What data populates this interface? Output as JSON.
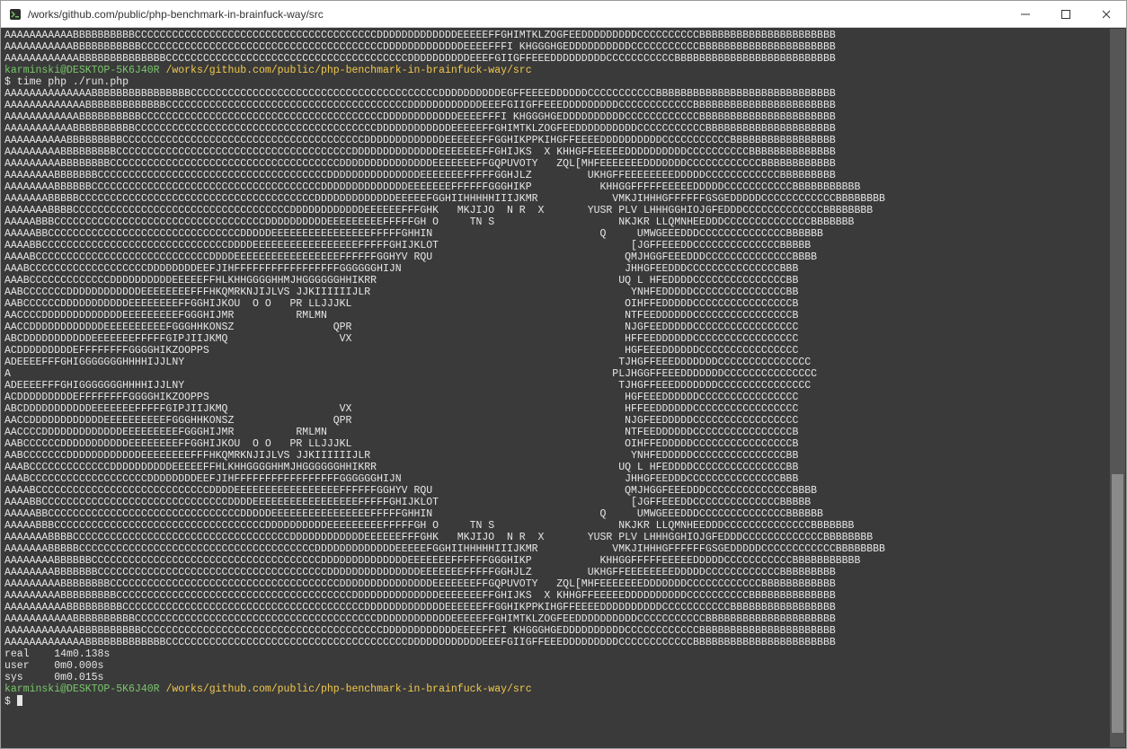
{
  "window": {
    "title": "/works/github.com/public/php-benchmark-in-brainfuck-way/src"
  },
  "prompt": {
    "user_host": "karminski@DESKTOP-5K6J40R",
    "path": "/works/github.com/public/php-benchmark-in-brainfuck-way/src",
    "command": "$ time php ./run.php",
    "final_prompt": "$ "
  },
  "timing": {
    "real_label": "real",
    "real_value": "14m0.138s",
    "user_label": "user",
    "user_value": "0m0.000s",
    "sys_label": "sys",
    "sys_value": "0m0.015s"
  },
  "top_lines": [
    "AAAAAAAAAAABBBBBBBBBBCCCCCCCCCCCCCCCCCCCCCCCCCCCCCCCCCCCCCCCDDDDDDDDDDDDDEEEEEFFGHIMTKLZOGFEEDDDDDDDDDCCCCCCCCCCBBBBBBBBBBBBBBBBBBBBBB",
    "AAAAAAAAAAABBBBBBBBBBBCCCCCCCCCCCCCCCCCCCCCCCCCCCCCCCCCCCCCCCDDDDDDDDDDDDDEEEEFFFI KHGGGHGEDDDDDDDDDDCCCCCCCCCCCBBBBBBBBBBBBBBBBBBBBBB",
    "AAAAAAAAAAAABBBBBBBBBBBBBBCCCCCCCCCCCCCCCCCCCCCCCCCCCCCCCCCCCCCCCDDDDDDDDDDEEEFGIIGFFEEEDDDDDDDDDCCCCCCCCCCCBBBBBBBBBBBBBBBBBBBBBBBBBB"
  ],
  "run_lines": [
    "AAAAAAAAAAAAAABBBBBBBBBBBBBBBBCCCCCCCCCCCCCCCCCCCCCCCCCCCCCCCCCCCCCCCCDDDDDDDDDDEGFFEEEEDDDDDDCCCCCCCCCCCBBBBBBBBBBBBBBBBBBBBBBBBBBBBB",
    "AAAAAAAAAAAAABBBBBBBBBBBBBCCCCCCCCCCCCCCCCCCCCCCCCCCCCCCCCCCCCCCCDDDDDDDDDDDDEEEFGIIGFFEEEDDDDDDDDDCCCCCCCCCCCCBBBBBBBBBBBBBBBBBBBBBBB",
    "AAAAAAAAAAAABBBBBBBBBBCCCCCCCCCCCCCCCCCCCCCCCCCCCCCCCCCCCCCCCDDDDDDDDDDDDEEEEFFFI KHGGGHGEDDDDDDDDDDCCCCCCCCCCCCBBBBBBBBBBBBBBBBBBBBBB",
    "AAAAAAAAAAABBBBBBBBBBCCCCCCCCCCCCCCCCCCCCCCCCCCCCCCCCCCCCCCCDDDDDDDDDDDDEEEEEFFGHIMTKLZOGFEEDDDDDDDDDDCCCCCCCCCCCBBBBBBBBBBBBBBBBBBBBB",
    "AAAAAAAAAABBBBBBBBBCCCCCCCCCCCCCCCCCCCCCCCCCCCCCCCCCCCCCCCDDDDDDDDDDDDDEEEEEEFFGGHIKPPKIHGFFEEEEDDDDDDDDDDCCCCCCCCCCCBBBBBBBBBBBBBBBBB",
    "AAAAAAAAABBBBBBBBBCCCCCCCCCCCCCCCCCCCCCCCCCCCCCCCCCCCCCCDDDDDDDDDDDDDDEEEEEEEFFGHIJKS  X KHHGFFEEEEEDDDDDDDDDDCCCCCCCCCCBBBBBBBBBBBBBB",
    "AAAAAAAAABBBBBBBBCCCCCCCCCCCCCCCCCCCCCCCCCCCCCCCCCCCCCDDDDDDDDDDDDDDDEEEEEEEFFGQPUVOTY   ZQL[MHFEEEEEEEDDDDDDDCCCCCCCCCCCCBBBBBBBBBBBB",
    "AAAAAAAABBBBBBBCCCCCCCCCCCCCCCCCCCCCCCCCCCCCCCCCCCCCDDDDDDDDDDDDDDDEEEEEEEFFFFFGGHJLZ         UKHGFFEEEEEEEEDDDDDCCCCCCCCCCCCBBBBBBBBB",
    "AAAAAAAABBBBBBCCCCCCCCCCCCCCCCCCCCCCCCCCCCCCCCCCCCCDDDDDDDDDDDDDDEEEEEEEFFFFFFGGGHIKP           KHHGGFFFFFEEEEEDDDDDCCCCCCCCCCCBBBBBBBBBBB",
    "AAAAAAABBBBBCCCCCCCCCCCCCCCCCCCCCCCCCCCCCCCCCCCCCCDDDDDDDDDDDDDEEEEEFGGHIIHHHHHIIIJKMR            VMKJIHHHGFFFFFFGSGEDDDDDCCCCCCCCCCCCBBBBBBBB",
    "AAAAAAABBBBCCCCCCCCCCCCCCCCCCCCCCCCCCCCCCCCCCCDDDDDDDDDDDDEEEEEEFFFGHK   MKJIJO  N R  X       YUSR PLV LHHHGGHIOJGFEDDDCCCCCCCCCCCCCBBBBBBBB",
    "AAAAABBBCCCCCCCCCCCCCCCCCCCCCCCCCCCCCCCCCCDDDDDDDDDDEEEEEEEEEFFFFFGH O     TN S                    NKJKR LLQMNHEEDDDCCCCCCCCCCCCCCBBBBBBB",
    "AAAAABBCCCCCCCCCCCCCCCCCCCCCCCCCCCCCCCDDDDDEEEEEEEEEEEEEEEEFFFFFGHHIN                           Q     UMWGEEEDDDCCCCCCCCCCCCCCBBBBBB",
    "AAAABBCCCCCCCCCCCCCCCCCCCCCCCCCCCCCCDDDDEEEEEEEEEEEEEEEEEFFFFFGHIJKLOT                               [JGFFEEEDDCCCCCCCCCCCCCCBBBBB",
    "AAAABCCCCCCCCCCCCCCCCCCCCCCCCCCCCDDDDEEEEEEEEEEEEEEEEEFFFFFFGGHYV RQU                               QMJHGGFEEEDDDCCCCCCCCCCCCCCBBBB",
    "AAABCCCCCCCCCCCCCCCCCCCDDDDDDDDEEFJIHFFFFFFFFFFFFFFFFFGGGGGGHIJN                                    JHHGFEEDDDCCCCCCCCCCCCCCCBBB",
    "AAABCCCCCCCCCCCCCDDDDDDDDDDEEEEEFFHLKHHGGGGHHMJHGGGGGGHHIKRR                                       UQ L HFEDDDDCCCCCCCCCCCCCCCBB",
    "AABCCCCCCCDDDDDDDDDDDDEEEEEEEEFFFHKQMRKNJIJLVS JJKIIIIIIJLR                                          YNHFEDDDDDCCCCCCCCCCCCCCCBB",
    "AABCCCCCCDDDDDDDDDDDEEEEEEEEFFGGHIJKOU  O O   PR LLJJJKL                                            OIHFFEDDDDDCCCCCCCCCCCCCCCCB",
    "AACCCCDDDDDDDDDDDDDEEEEEEEEEFGGGHIJMR          RMLMN                                                NTFEEDDDDDDCCCCCCCCCCCCCCCCB",
    "AACCDDDDDDDDDDDDEEEEEEEEEEFGGGHHKONSZ                QPR                                            NJGFEEDDDDDCCCCCCCCCCCCCCCCC",
    "ABCDDDDDDDDDDDEEEEEEEFFFFFGIPJIIJKMQ                  VX                                            HFFEEDDDDDDCCCCCCCCCCCCCCCCC",
    "ACDDDDDDDDDEFFFFFFFFGGGGHIKZOOPPS                                                                   HGFEEEDDDDDDCCCCCCCCCCCCCCCC",
    "ADEEEEFFFGHIGGGGGGGHHHHIJJLNY                                                                      TJHGFFEEEDDDDDDDCCCCCCCCCCCCCCC",
    "A                                                                                                 PLJHGGFFEEEDDDDDDDCCCCCCCCCCCCCCC",
    "ADEEEEFFFGHIGGGGGGGHHHHIJJLNY                                                                      TJHGFFEEEDDDDDDDCCCCCCCCCCCCCCC",
    "ACDDDDDDDDDEFFFFFFFFGGGGHIKZOOPPS                                                                   HGFEEEDDDDDDCCCCCCCCCCCCCCCC",
    "ABCDDDDDDDDDDDEEEEEEEFFFFFGIPJIIJKMQ                  VX                                            HFFEEDDDDDDCCCCCCCCCCCCCCCCC",
    "AACCDDDDDDDDDDDDEEEEEEEEEEFGGGHHKONSZ                QPR                                            NJGFEEDDDDDCCCCCCCCCCCCCCCCC",
    "AACCCCDDDDDDDDDDDDDEEEEEEEEEFGGGHIJMR          RMLMN                                                NTFEEDDDDDDCCCCCCCCCCCCCCCCB",
    "AABCCCCCCDDDDDDDDDDDEEEEEEEEFFGGHIJKOU  O O   PR LLJJJKL                                            OIHFFEDDDDDCCCCCCCCCCCCCCCCB",
    "AABCCCCCCCDDDDDDDDDDDDEEEEEEEEFFFHKQMRKNJIJLVS JJKIIIIIIJLR                                          YNHFEDDDDDCCCCCCCCCCCCCCCBB",
    "AAABCCCCCCCCCCCCCDDDDDDDDDDEEEEEFFHLKHHGGGGHHMJHGGGGGGHHIKRR                                       UQ L HFEDDDDCCCCCCCCCCCCCCCBB",
    "AAABCCCCCCCCCCCCCCCCCCCDDDDDDDDEEFJIHFFFFFFFFFFFFFFFFFGGGGGGHIJN                                    JHHGFEEDDDCCCCCCCCCCCCCCCBBB",
    "AAAABCCCCCCCCCCCCCCCCCCCCCCCCCCCCDDDDEEEEEEEEEEEEEEEEEFFFFFFGGHYV RQU                               QMJHGGFEEEDDDCCCCCCCCCCCCCCBBBB",
    "AAAABBCCCCCCCCCCCCCCCCCCCCCCCCCCCCCCDDDDEEEEEEEEEEEEEEEEEFFFFFGHIJKLOT                               [JGFFEEEDDCCCCCCCCCCCCCCBBBBB",
    "AAAAABBCCCCCCCCCCCCCCCCCCCCCCCCCCCCCCCDDDDDEEEEEEEEEEEEEEEEFFFFFGHHIN                           Q     UMWGEEEDDDCCCCCCCCCCCCCCBBBBBB",
    "AAAAABBBCCCCCCCCCCCCCCCCCCCCCCCCCCCCCCCCCCDDDDDDDDDDEEEEEEEEEFFFFFGH O     TN S                    NKJKR LLQMNHEEDDDCCCCCCCCCCCCCCBBBBBBB",
    "AAAAAAABBBBCCCCCCCCCCCCCCCCCCCCCCCCCCCCCCCCCCCDDDDDDDDDDDDEEEEEEFFFGHK   MKJIJO  N R  X       YUSR PLV LHHHGGHIOJGFEDDDCCCCCCCCCCCCCBBBBBBBB",
    "AAAAAAABBBBBCCCCCCCCCCCCCCCCCCCCCCCCCCCCCCCCCCCCCCDDDDDDDDDDDDDEEEEEFGGHIIHHHHHIIIJKMR            VMKJIHHHGFFFFFFGSGEDDDDDCCCCCCCCCCCCBBBBBBBB",
    "AAAAAAAABBBBBBCCCCCCCCCCCCCCCCCCCCCCCCCCCCCCCCCCCCCDDDDDDDDDDDDDDEEEEEEEFFFFFFGGGHIKP           KHHGGFFFFFEEEEEDDDDDCCCCCCCCCCCBBBBBBBBBBB",
    "AAAAAAAABBBBBBBCCCCCCCCCCCCCCCCCCCCCCCCCCCCCCCCCCCCCDDDDDDDDDDDDDDDEEEEEEEFFFFFGGHJLZ         UKHGFFEEEEEEEEDDDDDCCCCCCCCCCCCBBBBBBBBB",
    "AAAAAAAAABBBBBBBBCCCCCCCCCCCCCCCCCCCCCCCCCCCCCCCCCCCCCDDDDDDDDDDDDDDDEEEEEEEFFGQPUVOTY   ZQL[MHFEEEEEEEDDDDDDDCCCCCCCCCCCCBBBBBBBBBBBB",
    "AAAAAAAAABBBBBBBBBCCCCCCCCCCCCCCCCCCCCCCCCCCCCCCCCCCCCCCDDDDDDDDDDDDDDEEEEEEEFFGHIJKS  X KHHGFFEEEEEDDDDDDDDDDCCCCCCCCCCBBBBBBBBBBBBBB",
    "AAAAAAAAAABBBBBBBBBCCCCCCCCCCCCCCCCCCCCCCCCCCCCCCCCCCCCCCCDDDDDDDDDDDDDEEEEEEFFGGHIKPPKIHGFFEEEEDDDDDDDDDDCCCCCCCCCCCBBBBBBBBBBBBBBBBB",
    "AAAAAAAAAAABBBBBBBBBBCCCCCCCCCCCCCCCCCCCCCCCCCCCCCCCCCCCCCCCDDDDDDDDDDDDEEEEEFFGHIMTKLZOGFEEDDDDDDDDDDCCCCCCCCCCCBBBBBBBBBBBBBBBBBBBBB",
    "AAAAAAAAAAAABBBBBBBBBBCCCCCCCCCCCCCCCCCCCCCCCCCCCCCCCCCCCCCCCDDDDDDDDDDDDEEEEFFFI KHGGGHGEDDDDDDDDDDCCCCCCCCCCCCBBBBBBBBBBBBBBBBBBBBBB",
    "AAAAAAAAAAAAABBBBBBBBBBBBBCCCCCCCCCCCCCCCCCCCCCCCCCCCCCCCCCCCCCCCDDDDDDDDDDDDEEEFGIIGFFEEEDDDDDDDDDCCCCCCCCCCCCBBBBBBBBBBBBBBBBBBBBBBB"
  ],
  "scrollbar": {
    "thumb_top_pct": 62,
    "thumb_height_pct": 36
  }
}
